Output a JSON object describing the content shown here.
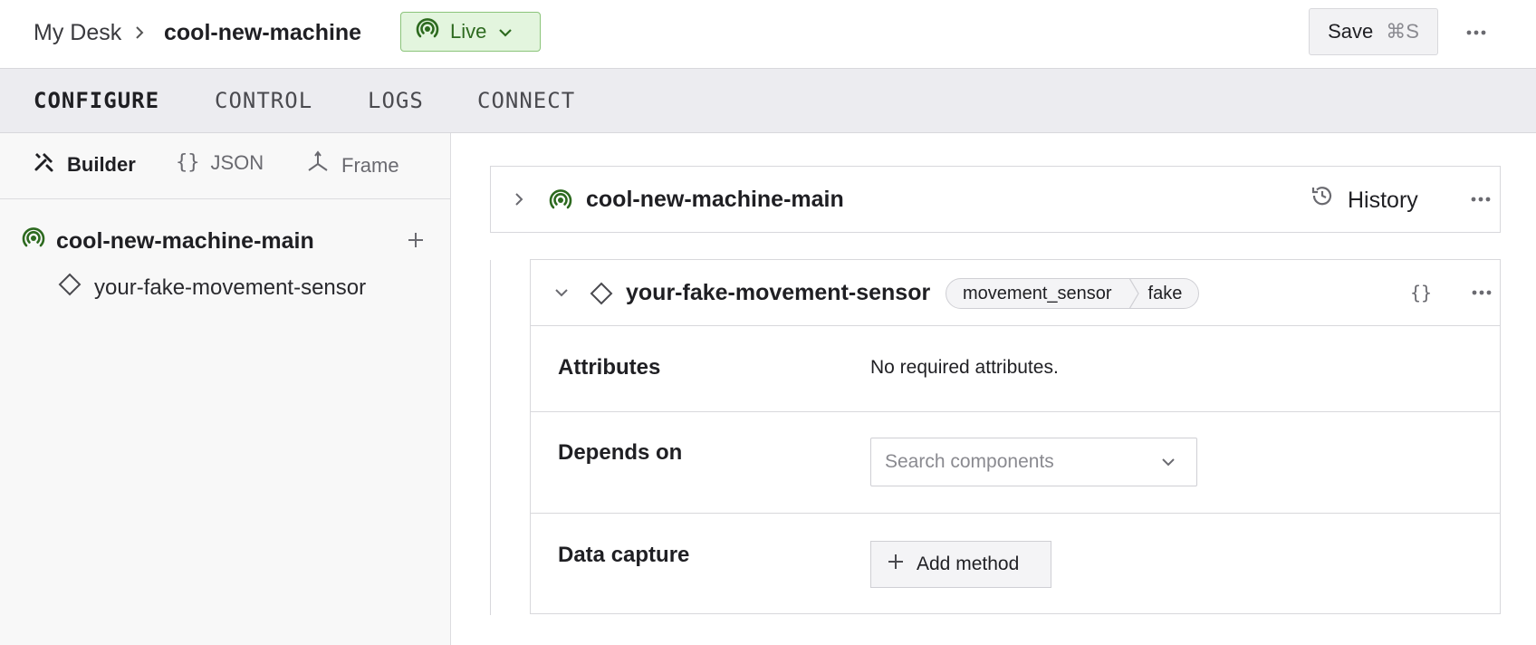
{
  "header": {
    "breadcrumb_parent": "My Desk",
    "breadcrumb_separator": "›",
    "breadcrumb_current": "cool-new-machine",
    "status_label": "Live",
    "save_label": "Save",
    "save_shortcut": "⌘S"
  },
  "tabs": [
    {
      "label": "CONFIGURE",
      "active": true
    },
    {
      "label": "CONTROL",
      "active": false
    },
    {
      "label": "LOGS",
      "active": false
    },
    {
      "label": "CONNECT",
      "active": false
    }
  ],
  "sidebar": {
    "modes": [
      {
        "label": "Builder",
        "icon": "tools-icon",
        "active": true
      },
      {
        "label": "JSON",
        "icon": "braces-icon",
        "active": false
      },
      {
        "label": "Frame",
        "icon": "axes-icon",
        "active": false
      }
    ],
    "tree": {
      "root_label": "cool-new-machine-main",
      "children": [
        {
          "label": "your-fake-movement-sensor"
        }
      ]
    }
  },
  "main": {
    "machine_part": {
      "name": "cool-new-machine-main",
      "history_label": "History"
    },
    "component": {
      "name": "your-fake-movement-sensor",
      "type": "movement_sensor",
      "model": "fake",
      "json_label": "{}",
      "attributes_label": "Attributes",
      "attributes_value": "No required attributes.",
      "depends_on_label": "Depends on",
      "depends_on_placeholder": "Search components",
      "data_capture_label": "Data capture",
      "add_method_label": "Add method"
    }
  },
  "colors": {
    "live_green": "#2d6a1f",
    "live_bg": "#e3f5de",
    "tab_bar_bg": "#ececf0",
    "sidebar_bg": "#f8f8f8"
  }
}
